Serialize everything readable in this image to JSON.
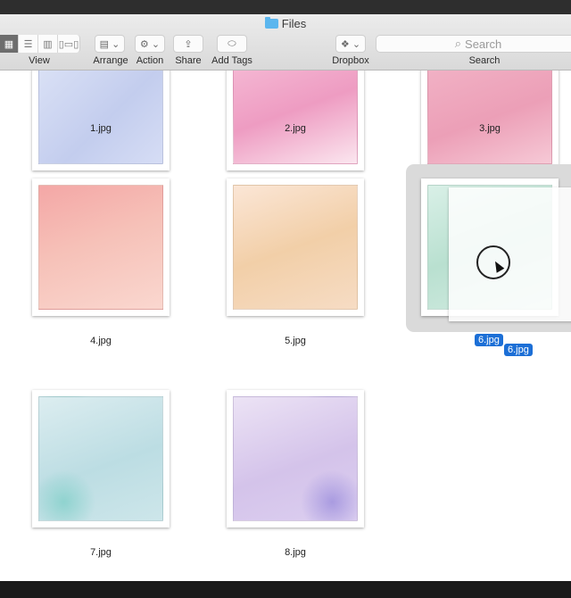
{
  "window": {
    "title": "Files"
  },
  "toolbar": {
    "view_label": "View",
    "arrange_label": "Arrange",
    "action_label": "Action",
    "share_label": "Share",
    "add_tags_label": "Add Tags",
    "dropbox_label": "Dropbox",
    "search_label": "Search",
    "search_placeholder": "Search",
    "view_modes": [
      "icon",
      "list",
      "column",
      "cover-flow"
    ],
    "active_view": "icon"
  },
  "files": [
    {
      "name": "1.jpg",
      "color": "#c9d2f0"
    },
    {
      "name": "2.jpg",
      "color": "#f2b3cf"
    },
    {
      "name": "3.jpg",
      "color": "#f0b2c6"
    },
    {
      "name": "4.jpg",
      "color": "#f2b6b0"
    },
    {
      "name": "5.jpg",
      "color": "#f5d7bd"
    },
    {
      "name": "6.jpg",
      "color": "#c9e9dc",
      "selected": true
    },
    {
      "name": "7.jpg",
      "color": "#c6e3e6"
    },
    {
      "name": "8.jpg",
      "color": "#d6c6ea"
    }
  ],
  "drag": {
    "label": "6.jpg"
  },
  "colors": {
    "selection": "#1c6fd6"
  }
}
